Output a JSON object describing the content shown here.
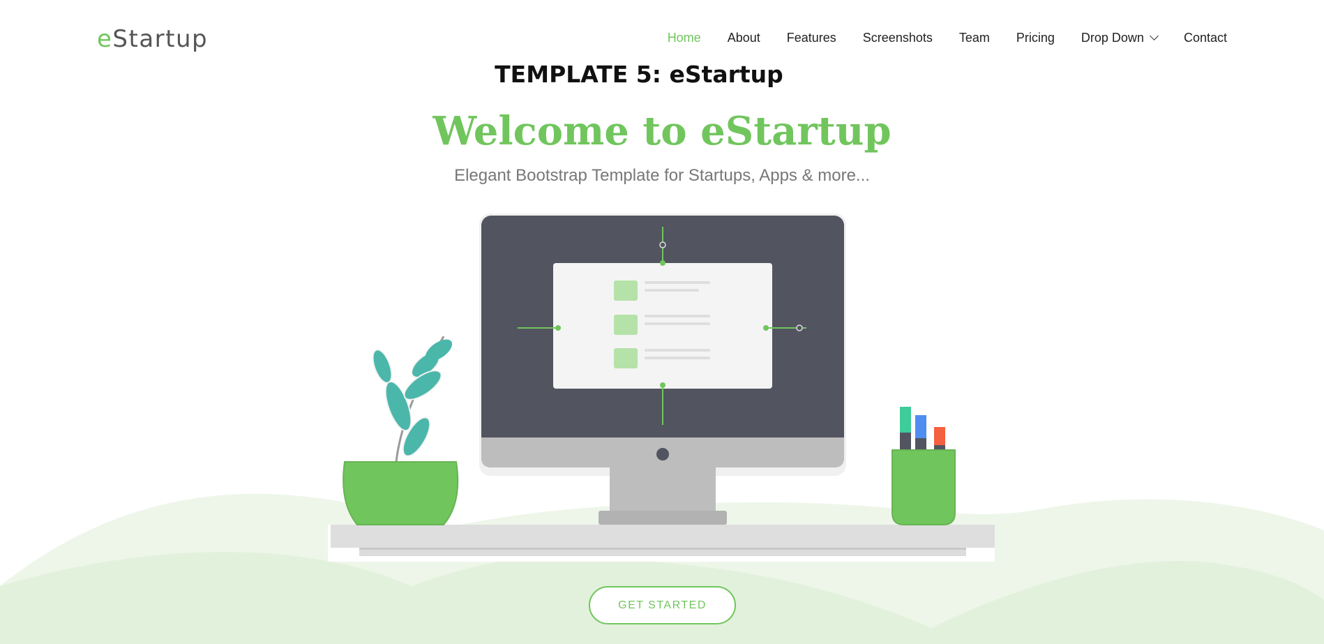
{
  "header": {
    "logo": {
      "prefix": "e",
      "rest": "Startup"
    },
    "nav": [
      {
        "label": "Home",
        "active": true
      },
      {
        "label": "About"
      },
      {
        "label": "Features"
      },
      {
        "label": "Screenshots"
      },
      {
        "label": "Team"
      },
      {
        "label": "Pricing"
      },
      {
        "label": "Drop Down",
        "has_dropdown": true
      },
      {
        "label": "Contact"
      }
    ]
  },
  "caption": "TEMPLATE 5: eStartup",
  "hero": {
    "title": "Welcome to eStartup",
    "subtitle": "Elegant Bootstrap Template for Startups, Apps & more..."
  },
  "cta": {
    "label": "GET STARTED"
  },
  "colors": {
    "accent": "#71c55d",
    "monitor": "#525460",
    "leaf": "#4bb7aa",
    "hill_light": "#eef6ea",
    "hill_mid": "#e2f1dc",
    "marker_green": "#3ecc9a",
    "marker_blue": "#4f8df0",
    "marker_red": "#f5603f"
  },
  "icons": {
    "dropdown": "chevron-down-icon"
  }
}
